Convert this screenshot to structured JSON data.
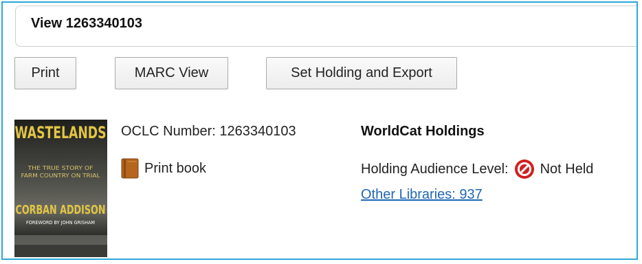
{
  "header": {
    "title": "View 1263340103"
  },
  "toolbar": {
    "print_label": "Print",
    "marc_label": "MARC View",
    "holding_label": "Set Holding and Export"
  },
  "record": {
    "oclc_label": "OCLC Number: 1263340103",
    "format_label": "Print book",
    "format_icon": "book-icon"
  },
  "cover": {
    "title": "WASTELANDS",
    "subtitle_line1": "THE TRUE STORY OF",
    "subtitle_line2": "FARM COUNTRY ON TRIAL",
    "author": "CORBAN ADDISON",
    "foreword": "FOREWORD BY JOHN GRISHAM"
  },
  "holdings": {
    "title": "WorldCat Holdings",
    "level_label": "Holding Audience Level:",
    "status_icon": "not-held-icon",
    "status": "Not Held",
    "other_libraries": "Other Libraries: 937"
  },
  "colors": {
    "frame_border": "#29a8d6",
    "link": "#1f66b5",
    "not_held": "#d0201f",
    "cover_text": "#e2c544"
  }
}
